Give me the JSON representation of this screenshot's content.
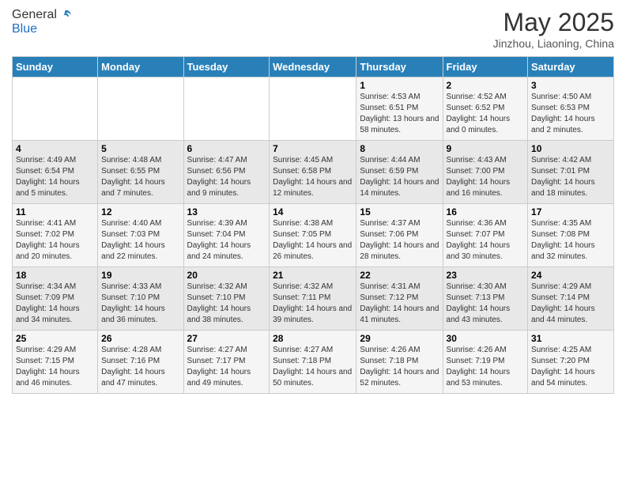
{
  "logo": {
    "line1": "General",
    "line2": "Blue"
  },
  "title": "May 2025",
  "location": "Jinzhou, Liaoning, China",
  "weekdays": [
    "Sunday",
    "Monday",
    "Tuesday",
    "Wednesday",
    "Thursday",
    "Friday",
    "Saturday"
  ],
  "weeks": [
    [
      {
        "day": "",
        "info": ""
      },
      {
        "day": "",
        "info": ""
      },
      {
        "day": "",
        "info": ""
      },
      {
        "day": "",
        "info": ""
      },
      {
        "day": "1",
        "info": "Sunrise: 4:53 AM\nSunset: 6:51 PM\nDaylight: 13 hours and 58 minutes."
      },
      {
        "day": "2",
        "info": "Sunrise: 4:52 AM\nSunset: 6:52 PM\nDaylight: 14 hours and 0 minutes."
      },
      {
        "day": "3",
        "info": "Sunrise: 4:50 AM\nSunset: 6:53 PM\nDaylight: 14 hours and 2 minutes."
      }
    ],
    [
      {
        "day": "4",
        "info": "Sunrise: 4:49 AM\nSunset: 6:54 PM\nDaylight: 14 hours and 5 minutes."
      },
      {
        "day": "5",
        "info": "Sunrise: 4:48 AM\nSunset: 6:55 PM\nDaylight: 14 hours and 7 minutes."
      },
      {
        "day": "6",
        "info": "Sunrise: 4:47 AM\nSunset: 6:56 PM\nDaylight: 14 hours and 9 minutes."
      },
      {
        "day": "7",
        "info": "Sunrise: 4:45 AM\nSunset: 6:58 PM\nDaylight: 14 hours and 12 minutes."
      },
      {
        "day": "8",
        "info": "Sunrise: 4:44 AM\nSunset: 6:59 PM\nDaylight: 14 hours and 14 minutes."
      },
      {
        "day": "9",
        "info": "Sunrise: 4:43 AM\nSunset: 7:00 PM\nDaylight: 14 hours and 16 minutes."
      },
      {
        "day": "10",
        "info": "Sunrise: 4:42 AM\nSunset: 7:01 PM\nDaylight: 14 hours and 18 minutes."
      }
    ],
    [
      {
        "day": "11",
        "info": "Sunrise: 4:41 AM\nSunset: 7:02 PM\nDaylight: 14 hours and 20 minutes."
      },
      {
        "day": "12",
        "info": "Sunrise: 4:40 AM\nSunset: 7:03 PM\nDaylight: 14 hours and 22 minutes."
      },
      {
        "day": "13",
        "info": "Sunrise: 4:39 AM\nSunset: 7:04 PM\nDaylight: 14 hours and 24 minutes."
      },
      {
        "day": "14",
        "info": "Sunrise: 4:38 AM\nSunset: 7:05 PM\nDaylight: 14 hours and 26 minutes."
      },
      {
        "day": "15",
        "info": "Sunrise: 4:37 AM\nSunset: 7:06 PM\nDaylight: 14 hours and 28 minutes."
      },
      {
        "day": "16",
        "info": "Sunrise: 4:36 AM\nSunset: 7:07 PM\nDaylight: 14 hours and 30 minutes."
      },
      {
        "day": "17",
        "info": "Sunrise: 4:35 AM\nSunset: 7:08 PM\nDaylight: 14 hours and 32 minutes."
      }
    ],
    [
      {
        "day": "18",
        "info": "Sunrise: 4:34 AM\nSunset: 7:09 PM\nDaylight: 14 hours and 34 minutes."
      },
      {
        "day": "19",
        "info": "Sunrise: 4:33 AM\nSunset: 7:10 PM\nDaylight: 14 hours and 36 minutes."
      },
      {
        "day": "20",
        "info": "Sunrise: 4:32 AM\nSunset: 7:10 PM\nDaylight: 14 hours and 38 minutes."
      },
      {
        "day": "21",
        "info": "Sunrise: 4:32 AM\nSunset: 7:11 PM\nDaylight: 14 hours and 39 minutes."
      },
      {
        "day": "22",
        "info": "Sunrise: 4:31 AM\nSunset: 7:12 PM\nDaylight: 14 hours and 41 minutes."
      },
      {
        "day": "23",
        "info": "Sunrise: 4:30 AM\nSunset: 7:13 PM\nDaylight: 14 hours and 43 minutes."
      },
      {
        "day": "24",
        "info": "Sunrise: 4:29 AM\nSunset: 7:14 PM\nDaylight: 14 hours and 44 minutes."
      }
    ],
    [
      {
        "day": "25",
        "info": "Sunrise: 4:29 AM\nSunset: 7:15 PM\nDaylight: 14 hours and 46 minutes."
      },
      {
        "day": "26",
        "info": "Sunrise: 4:28 AM\nSunset: 7:16 PM\nDaylight: 14 hours and 47 minutes."
      },
      {
        "day": "27",
        "info": "Sunrise: 4:27 AM\nSunset: 7:17 PM\nDaylight: 14 hours and 49 minutes."
      },
      {
        "day": "28",
        "info": "Sunrise: 4:27 AM\nSunset: 7:18 PM\nDaylight: 14 hours and 50 minutes."
      },
      {
        "day": "29",
        "info": "Sunrise: 4:26 AM\nSunset: 7:18 PM\nDaylight: 14 hours and 52 minutes."
      },
      {
        "day": "30",
        "info": "Sunrise: 4:26 AM\nSunset: 7:19 PM\nDaylight: 14 hours and 53 minutes."
      },
      {
        "day": "31",
        "info": "Sunrise: 4:25 AM\nSunset: 7:20 PM\nDaylight: 14 hours and 54 minutes."
      }
    ]
  ]
}
